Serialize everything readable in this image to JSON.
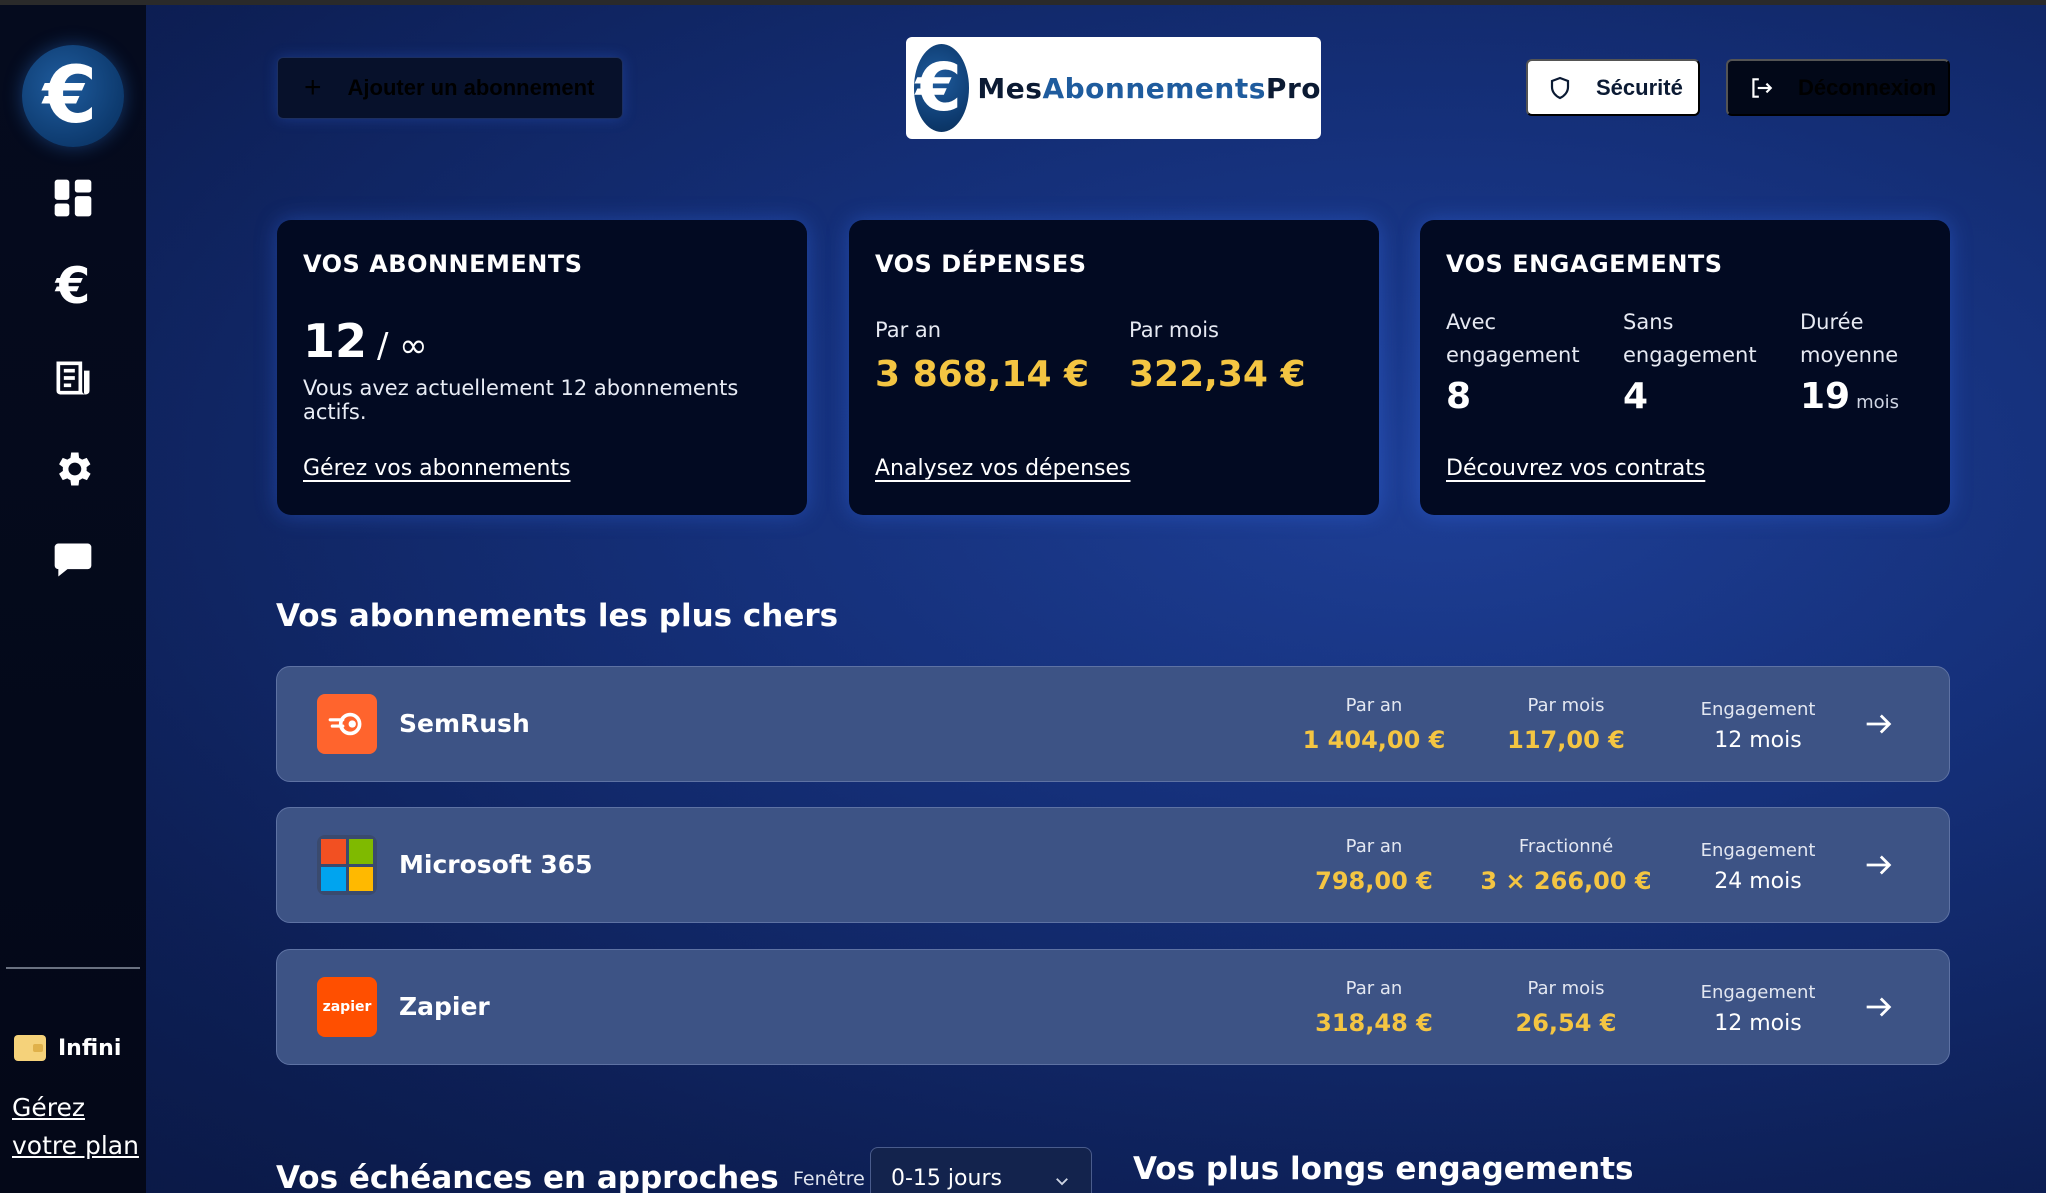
{
  "sidebar": {
    "logo_glyph": "€",
    "items": [
      {
        "icon": "dashboard-icon"
      },
      {
        "icon": "euro-icon",
        "glyph": "€"
      },
      {
        "icon": "document-icon"
      },
      {
        "icon": "gear-icon"
      },
      {
        "icon": "chat-icon"
      }
    ],
    "plan_label": "Infini",
    "manage_plan": "Gérez votre plan"
  },
  "header": {
    "add_button": "Ajouter un abonnement",
    "brand": {
      "part1": "Mes",
      "part2": "Abonnements",
      "part3": "Pro",
      "glyph": "€"
    },
    "security_button": "Sécurité",
    "logout_button": "Déconnexion"
  },
  "cards": {
    "subscriptions": {
      "title": "VOS ABONNEMENTS",
      "count": "12",
      "limit": "/ ∞",
      "subtitle": "Vous avez actuellement 12 abonnements actifs.",
      "link": "Gérez vos abonnements"
    },
    "expenses": {
      "title": "VOS DÉPENSES",
      "yearly_label": "Par an",
      "yearly_value": "3 868,14 €",
      "monthly_label": "Par mois",
      "monthly_value": "322,34 €",
      "link": "Analysez vos dépenses"
    },
    "commitments": {
      "title": "VOS ENGAGEMENTS",
      "with_label": "Avec engagement",
      "with_value": "8",
      "without_label": "Sans engagement",
      "without_value": "4",
      "avg_label": "Durée moyenne",
      "avg_value": "19",
      "avg_unit": "mois",
      "link": "Découvrez vos contrats"
    }
  },
  "expensive": {
    "title": "Vos abonnements les plus chers",
    "rows": [
      {
        "name": "SemRush",
        "m1_label": "Par an",
        "m1_value": "1 404,00 €",
        "m2_label": "Par mois",
        "m2_value": "117,00 €",
        "eng_label": "Engagement",
        "eng_value": "12 mois"
      },
      {
        "name": "Microsoft 365",
        "m1_label": "Par an",
        "m1_value": "798,00 €",
        "m2_label": "Fractionné",
        "m2_value": "3 × 266,00 €",
        "eng_label": "Engagement",
        "eng_value": "24 mois"
      },
      {
        "name": "Zapier",
        "logo_text": "zapier",
        "m1_label": "Par an",
        "m1_value": "318,48 €",
        "m2_label": "Par mois",
        "m2_value": "26,54 €",
        "eng_label": "Engagement",
        "eng_value": "12 mois"
      }
    ]
  },
  "upcoming": {
    "title": "Vos échéances en approches",
    "window_label": "Fenêtre",
    "window_value": "0-15 jours"
  },
  "longest": {
    "title": "Vos plus longs engagements"
  },
  "colors": {
    "accent_gold": "#f4c542",
    "card_bg": "#020a22",
    "row_bg": "#3d5385"
  }
}
